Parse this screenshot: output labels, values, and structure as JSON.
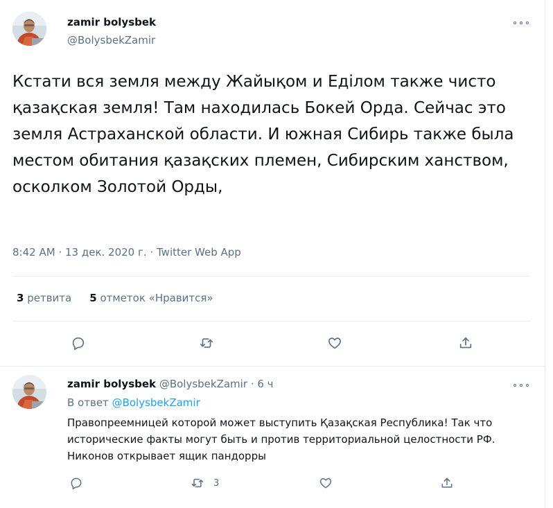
{
  "tweet": {
    "author_name": "zamir bolysbek",
    "author_handle": "@BolysbekZamir",
    "text": "Кстати вся земля между Жайықом и Еділом также чисто қазақская земля! Там находилась Бокей Орда. Сейчас это земля Астраханской области. И южная Сибирь также была местом обитания қазақских племен, Сибирским ханством, осколком Золотой Орды,",
    "time": "8:42 AM",
    "dot": "·",
    "date": "13 дек. 2020 г.",
    "source": "Twitter Web App",
    "retweets_count": "3",
    "retweets_label": "ретвита",
    "likes_count": "5",
    "likes_label": "отметок «Нравится»"
  },
  "reply": {
    "author_name": "zamir bolysbek",
    "author_handle": "@BolysbekZamir",
    "dot": "·",
    "time_ago": "6 ч",
    "reply_prefix": "В ответ",
    "reply_to": "@BolysbekZamir",
    "text": "Правопреемницей которой может выступить Қазақская Республика! Так что исторические факты могут быть и против территориальной целостности РФ. Никонов открывает ящик пандорры",
    "retweet_count": "3"
  },
  "icons": {
    "more": "more-horizontal-icon",
    "reply": "reply-icon",
    "retweet": "retweet-icon",
    "like": "heart-icon",
    "share": "share-icon"
  },
  "colors": {
    "accent": "#1da1f2",
    "text": "#0f1419",
    "secondary": "#5b7083",
    "divider": "#e6ecf0"
  }
}
